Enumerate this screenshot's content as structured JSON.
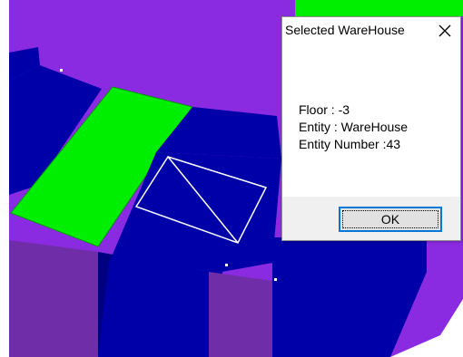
{
  "dialog": {
    "title": "Selected WareHouse",
    "close_glyph": "✕",
    "floor_text": "Floor : -3",
    "entity_text": "Entity : WareHouse",
    "entity_number_text": "Entity Number :43",
    "ok_label": "OK"
  },
  "scene": {
    "colors": {
      "background": "#ffffff",
      "ground": "#8a2be2",
      "block": "#0000a8",
      "block_dark": "#000080",
      "selected": "#00ee00",
      "wall": "#6f2da8",
      "wall_dark": "#5b2490",
      "outline": "#ffffff"
    }
  }
}
